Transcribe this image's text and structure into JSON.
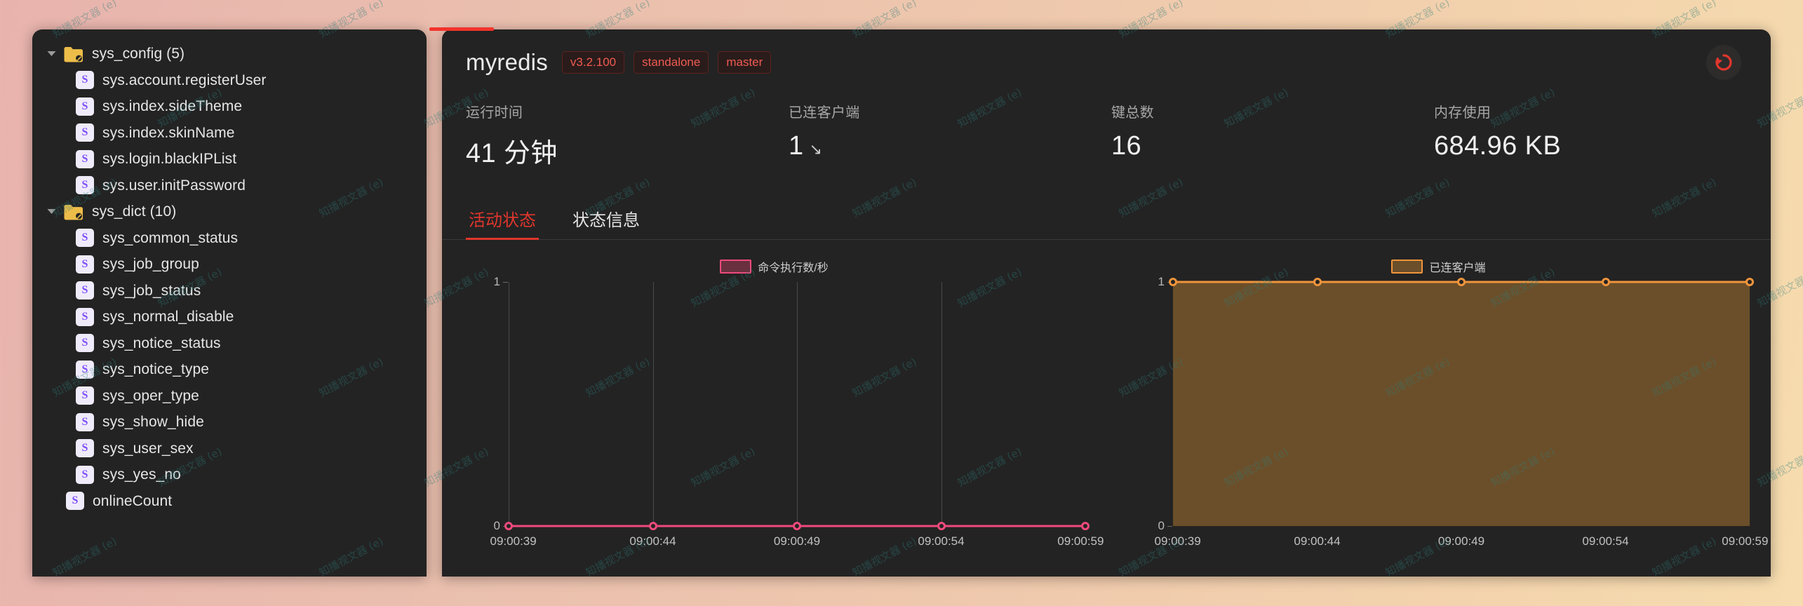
{
  "sidebar": {
    "items": [
      {
        "label": "sys_config (5)",
        "type": "folder",
        "depth": 0,
        "expanded": true,
        "icon": "folder-open-icon"
      },
      {
        "label": "sys.account.registerUser",
        "type": "leaf",
        "depth": 1,
        "icon": "string-type-icon"
      },
      {
        "label": "sys.index.sideTheme",
        "type": "leaf",
        "depth": 1,
        "icon": "string-type-icon"
      },
      {
        "label": "sys.index.skinName",
        "type": "leaf",
        "depth": 1,
        "icon": "string-type-icon"
      },
      {
        "label": "sys.login.blackIPList",
        "type": "leaf",
        "depth": 1,
        "icon": "string-type-icon"
      },
      {
        "label": "sys.user.initPassword",
        "type": "leaf",
        "depth": 1,
        "icon": "string-type-icon"
      },
      {
        "label": "sys_dict (10)",
        "type": "folder",
        "depth": 0,
        "expanded": true,
        "icon": "folder-open-icon"
      },
      {
        "label": "sys_common_status",
        "type": "leaf",
        "depth": 1,
        "icon": "string-type-icon"
      },
      {
        "label": "sys_job_group",
        "type": "leaf",
        "depth": 1,
        "icon": "string-type-icon"
      },
      {
        "label": "sys_job_status",
        "type": "leaf",
        "depth": 1,
        "icon": "string-type-icon"
      },
      {
        "label": "sys_normal_disable",
        "type": "leaf",
        "depth": 1,
        "icon": "string-type-icon"
      },
      {
        "label": "sys_notice_status",
        "type": "leaf",
        "depth": 1,
        "icon": "string-type-icon"
      },
      {
        "label": "sys_notice_type",
        "type": "leaf",
        "depth": 1,
        "icon": "string-type-icon"
      },
      {
        "label": "sys_oper_type",
        "type": "leaf",
        "depth": 1,
        "icon": "string-type-icon"
      },
      {
        "label": "sys_show_hide",
        "type": "leaf",
        "depth": 1,
        "icon": "string-type-icon"
      },
      {
        "label": "sys_user_sex",
        "type": "leaf",
        "depth": 1,
        "icon": "string-type-icon"
      },
      {
        "label": "sys_yes_no",
        "type": "leaf",
        "depth": 1,
        "icon": "string-type-icon"
      },
      {
        "label": "onlineCount",
        "type": "leaf",
        "depth": 0,
        "icon": "string-type-icon"
      }
    ],
    "badge_letter": "S"
  },
  "header": {
    "server_name": "myredis",
    "tags": [
      "v3.2.100",
      "standalone",
      "master"
    ],
    "refresh_icon": "refresh-icon"
  },
  "stats": [
    {
      "label": "运行时间",
      "value": "41 分钟",
      "name": "uptime"
    },
    {
      "label": "已连客户端",
      "value": "1",
      "suffix": "↘",
      "name": "connected-clients"
    },
    {
      "label": "键总数",
      "value": "16",
      "name": "total-keys"
    },
    {
      "label": "内存使用",
      "value": "684.96 KB",
      "name": "memory-usage"
    }
  ],
  "tabs": [
    {
      "label": "活动状态",
      "active": true
    },
    {
      "label": "状态信息",
      "active": false
    }
  ],
  "colors": {
    "accent_red": "#e0362c",
    "pink": "#ef4a7c",
    "orange": "#f0953c",
    "orange_fill": "#6b4f2a",
    "panel_bg": "#232323",
    "tag_red": "#f05b52",
    "badge_purple": "#7d4dfb"
  },
  "chart_data": [
    {
      "type": "line",
      "name": "commands-per-second-chart",
      "title": "",
      "legend": [
        "命令执行数/秒"
      ],
      "legend_position": "top-center",
      "series": [
        {
          "name": "命令执行数/秒",
          "color": "#ef4a7c",
          "values": [
            0,
            0,
            0,
            0,
            0
          ]
        }
      ],
      "categories": [
        "09:00:39",
        "09:00:44",
        "09:00:49",
        "09:00:54",
        "09:00:59"
      ],
      "xlabel": "",
      "ylabel": "",
      "ylim": [
        0,
        1
      ],
      "yticks": [
        "0",
        "1"
      ],
      "grid": true,
      "area_fill": false
    },
    {
      "type": "area",
      "name": "connected-clients-chart",
      "title": "",
      "legend": [
        "已连客户端"
      ],
      "legend_position": "top-center",
      "series": [
        {
          "name": "已连客户端",
          "color": "#f0953c",
          "values": [
            1,
            1,
            1,
            1,
            1
          ]
        }
      ],
      "categories": [
        "09:00:39",
        "09:00:44",
        "09:00:49",
        "09:00:54",
        "09:00:59"
      ],
      "xlabel": "",
      "ylabel": "",
      "ylim": [
        0,
        1
      ],
      "yticks": [
        "0",
        "1"
      ],
      "grid": true,
      "area_fill": true
    }
  ]
}
